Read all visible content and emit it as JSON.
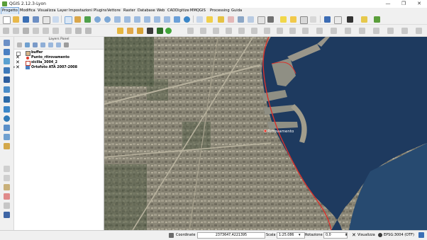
{
  "window": {
    "title": "QGIS 2.12.3-Lyon",
    "minimize_glyph": "—",
    "maximize_glyph": "❐",
    "close_glyph": "✕"
  },
  "menubar": {
    "items": [
      "Progetto",
      "Modifica",
      "Visualizza",
      "Layer",
      "Impostazioni",
      "Plugins",
      "Vettore",
      "Raster",
      "Database",
      "Web",
      "CADDigitize",
      "MMQGIS",
      "Processing",
      "Guida"
    ]
  },
  "layers_panel": {
    "title": "Layers Panel",
    "layers": [
      {
        "name": "buffer",
        "checked": false,
        "symbol": "polygon-outline"
      },
      {
        "name": "Punto_ritrovamento",
        "checked": true,
        "symbol": "point-red"
      },
      {
        "name": "sicilia_3004_2",
        "checked": true,
        "symbol": "polygon-outline"
      },
      {
        "name": "Ortofoto ATA 2007-2008",
        "checked": true,
        "symbol": "raster"
      }
    ]
  },
  "map": {
    "labels": [
      {
        "text": "Ritrovamento"
      }
    ],
    "colors": {
      "buffer_line": "#d8322c",
      "sea": "#1e3a5f",
      "urban": "#8a8676"
    }
  },
  "statusbar": {
    "coordinate_label": "Coordinate",
    "coordinate_value": "2373647,4221395",
    "scale_label": "Scala",
    "scale_value": "1:25.086",
    "rotation_label": "Rotazione",
    "rotation_value": "0,0",
    "render_label": "Visualizza",
    "render_checked": true,
    "crs": "EPSG:3004 (OTF)"
  }
}
